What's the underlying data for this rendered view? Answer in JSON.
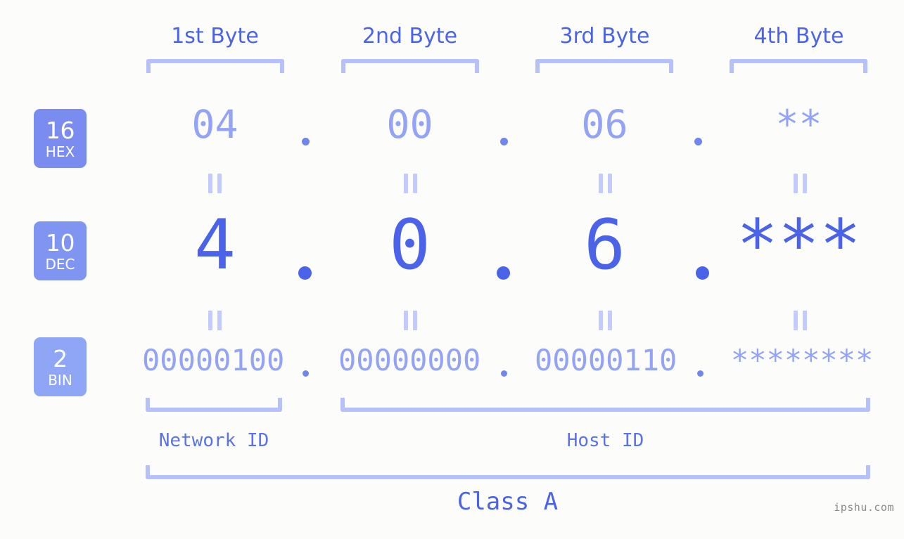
{
  "background_color": "#fcfdfa",
  "accent_colors": {
    "strong_blue": "#4a63e8",
    "light_blue": "#93a3f5",
    "bracket_blue": "#b6c0fb",
    "badge_hex": "#7b8cf0",
    "badge_dec": "#8094f2",
    "badge_bin": "#8ea6f5"
  },
  "byte_headers": [
    {
      "label": "1st Byte"
    },
    {
      "label": "2nd Byte"
    },
    {
      "label": "3rd Byte"
    },
    {
      "label": "4th Byte"
    }
  ],
  "radix_badges": [
    {
      "number": "16",
      "name": "HEX"
    },
    {
      "number": "10",
      "name": "DEC"
    },
    {
      "number": "2",
      "name": "BIN"
    }
  ],
  "rows": {
    "hex": {
      "radix": "16",
      "radix_name": "HEX",
      "values": [
        "04",
        "00",
        "06",
        "**"
      ],
      "separator": "."
    },
    "dec": {
      "radix": "10",
      "radix_name": "DEC",
      "values": [
        "4",
        "0",
        "6",
        "***"
      ],
      "separator": "."
    },
    "bin": {
      "radix": "2",
      "radix_name": "BIN",
      "values": [
        "00000100",
        "00000000",
        "00000110",
        "********"
      ],
      "separator": "."
    }
  },
  "equals_symbol": "||",
  "id_sections": [
    {
      "label": "Network ID"
    },
    {
      "label": "Host ID"
    }
  ],
  "class_label": "Class A",
  "watermark": "ipshu.com"
}
